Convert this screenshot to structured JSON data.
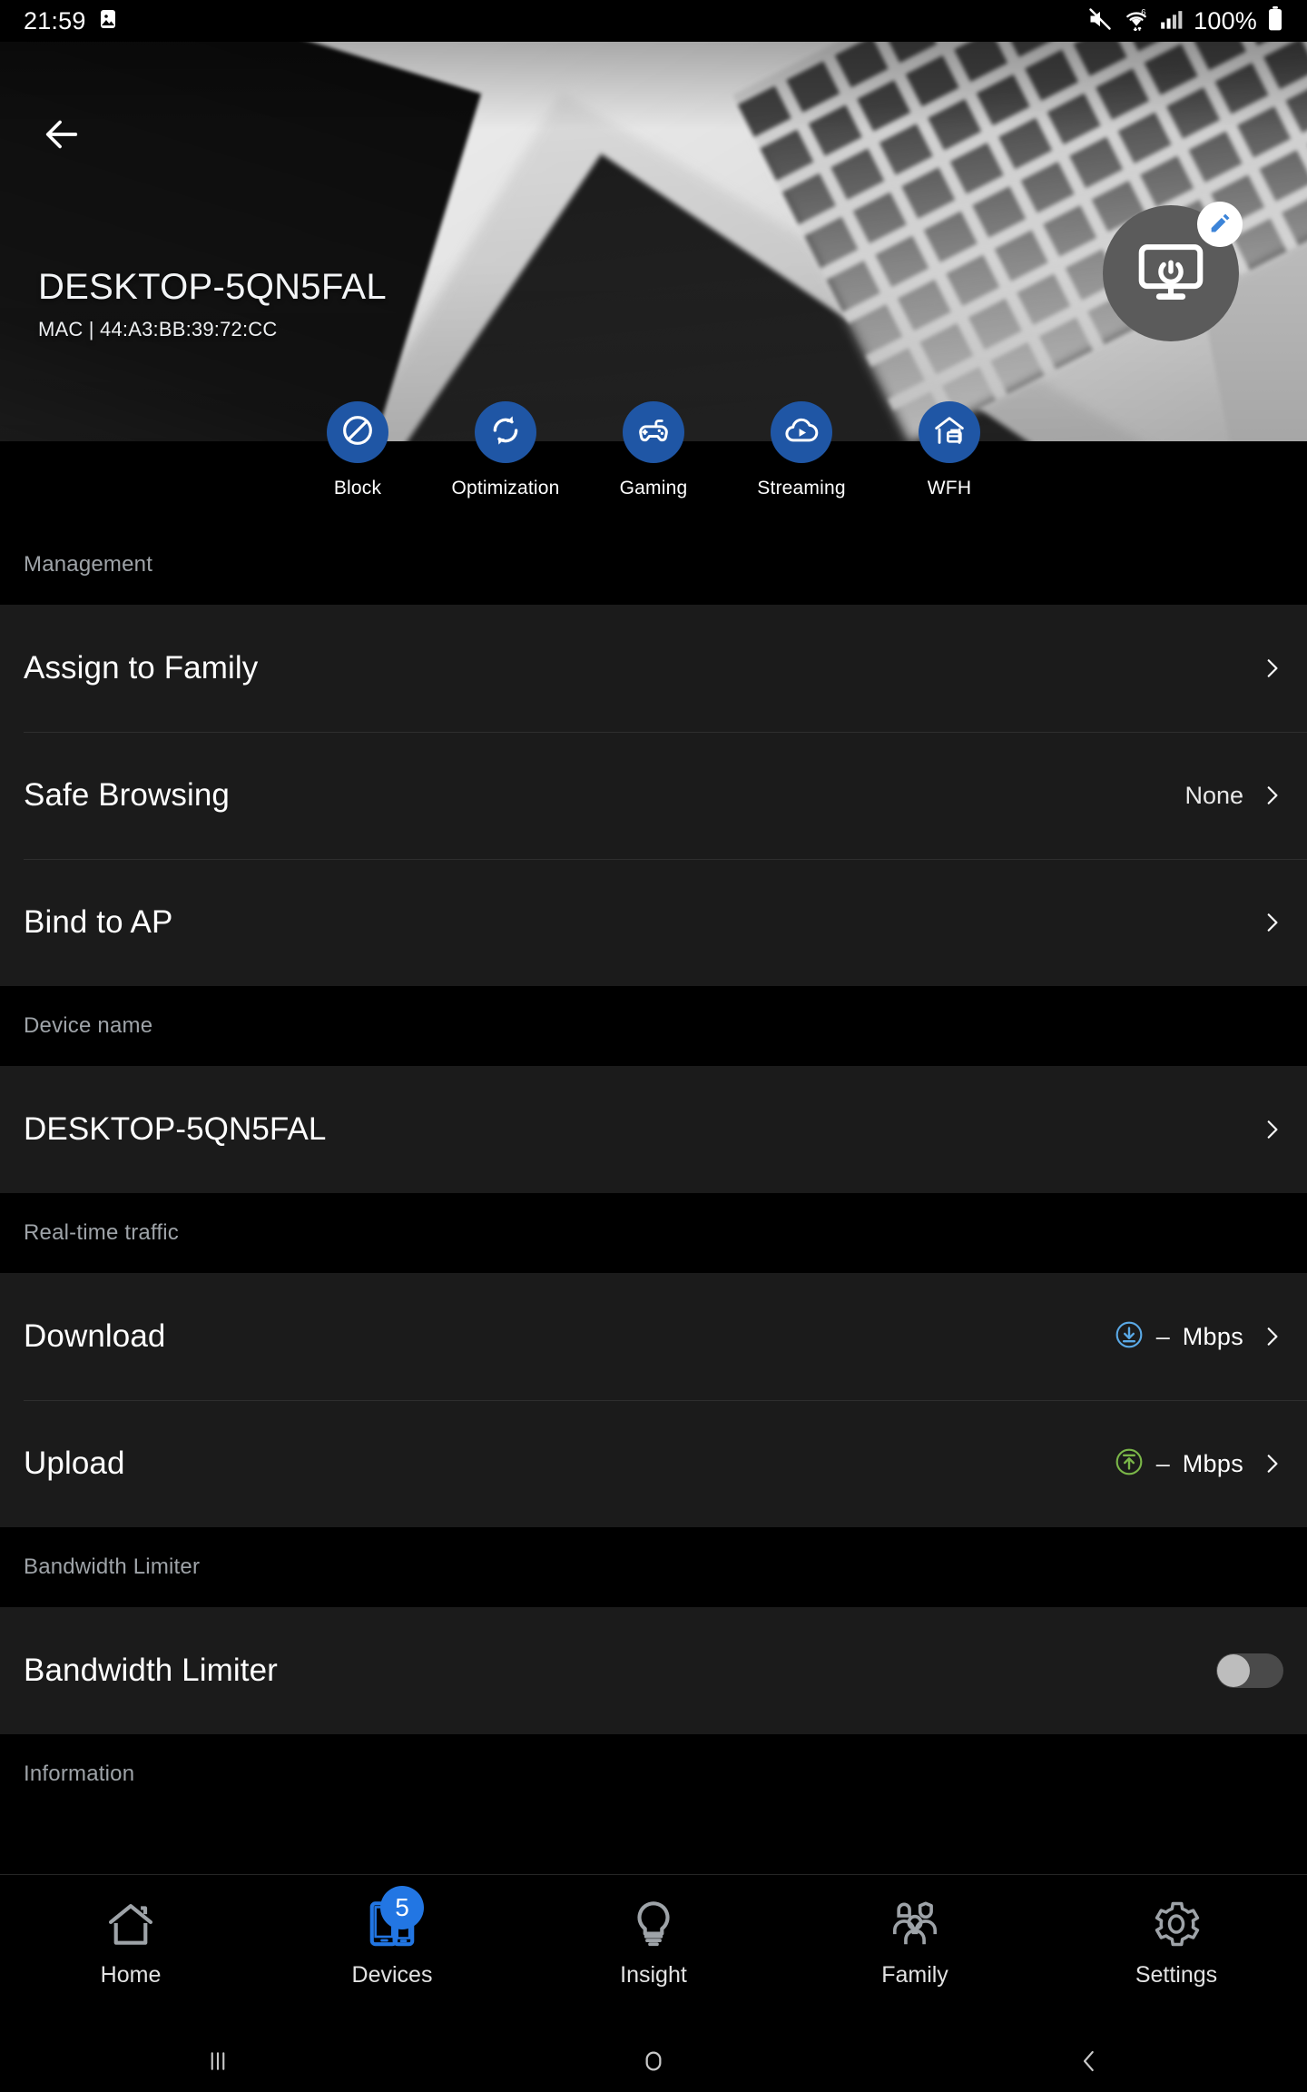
{
  "status_bar": {
    "time": "21:59",
    "icons_left": [
      "image-icon"
    ],
    "icons_right": [
      "mute-icon",
      "wifi-6-icon",
      "signal-bars-icon"
    ],
    "battery_percent": "100%",
    "battery_icon": "battery-full-icon"
  },
  "hero": {
    "back_icon": "back-arrow-icon",
    "device_name": "DESKTOP-5QN5FAL",
    "mac_label": "MAC | 44:A3:BB:39:72:CC",
    "avatar_icon": "desktop-monitor-power-icon",
    "edit_badge_icon": "pencil-edit-icon"
  },
  "actions": [
    {
      "label": "Block",
      "icon": "block-no-entry-icon"
    },
    {
      "label": "Optimization",
      "icon": "refresh-sync-icon"
    },
    {
      "label": "Gaming",
      "icon": "gamepad-icon"
    },
    {
      "label": "Streaming",
      "icon": "cloud-play-icon"
    },
    {
      "label": "WFH",
      "icon": "house-briefcase-icon"
    }
  ],
  "sections": {
    "management": {
      "header": "Management",
      "rows": [
        {
          "label": "Assign to Family",
          "value": ""
        },
        {
          "label": "Safe Browsing",
          "value": "None"
        },
        {
          "label": "Bind to AP",
          "value": ""
        }
      ]
    },
    "device_name": {
      "header": "Device name",
      "rows": [
        {
          "label": "DESKTOP-5QN5FAL",
          "value": ""
        }
      ]
    },
    "realtime_traffic": {
      "header": "Real-time traffic",
      "rows": [
        {
          "label": "Download",
          "value": "–",
          "unit": "Mbps",
          "icon": "download-circle-icon"
        },
        {
          "label": "Upload",
          "value": "–",
          "unit": "Mbps",
          "icon": "upload-circle-icon"
        }
      ]
    },
    "bandwidth_limiter": {
      "header": "Bandwidth Limiter",
      "rows": [
        {
          "label": "Bandwidth Limiter",
          "toggle_state": "off"
        }
      ]
    },
    "information": {
      "header": "Information"
    }
  },
  "bottom_nav": {
    "items": [
      {
        "label": "Home",
        "icon": "home-icon",
        "active": false,
        "badge": ""
      },
      {
        "label": "Devices",
        "icon": "devices-phones-icon",
        "active": true,
        "badge": "5"
      },
      {
        "label": "Insight",
        "icon": "lightbulb-icon",
        "active": false,
        "badge": ""
      },
      {
        "label": "Family",
        "icon": "people-group-icon",
        "active": false,
        "badge": ""
      },
      {
        "label": "Settings",
        "icon": "gear-icon",
        "active": false,
        "badge": ""
      }
    ]
  },
  "android_nav": {
    "recents_icon": "recents-icon",
    "home_icon": "home-circle-icon",
    "back_icon": "back-chevron-icon"
  },
  "colors": {
    "accent_blue": "#1f56a5",
    "nav_active_blue": "#2276e3",
    "download_icon": "#5aa9e6",
    "upload_icon": "#7ab648",
    "section_header_text": "#9ea3a8",
    "row_bg": "#1b1b1b",
    "page_bg": "#000000"
  }
}
